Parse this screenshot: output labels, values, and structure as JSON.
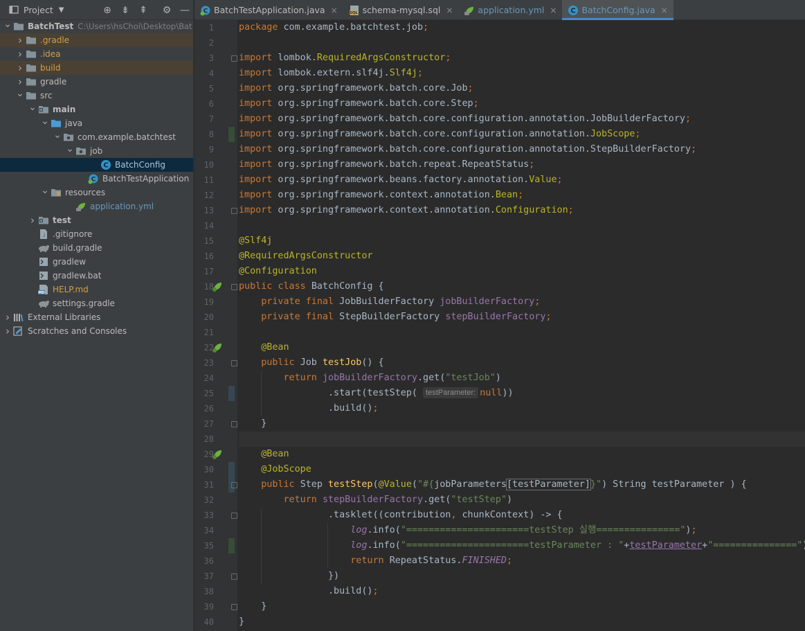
{
  "project_panel": {
    "title": "Project"
  },
  "tree": [
    {
      "label": "BatchTest",
      "path": "C:\\Users\\hsChoi\\Desktop\\Bat",
      "indent": 0,
      "arrow": "down",
      "icon": "folder-icon",
      "bold": true
    },
    {
      "label": ".gradle",
      "indent": 1,
      "arrow": "right",
      "icon": "folder-icon",
      "color": "#d0a043",
      "hl": "o"
    },
    {
      "label": ".idea",
      "indent": 1,
      "arrow": "right",
      "icon": "folder-icon",
      "color": "#d0a043"
    },
    {
      "label": "build",
      "indent": 1,
      "arrow": "right",
      "icon": "folder-icon",
      "color": "#d0a043",
      "hl": "o"
    },
    {
      "label": "gradle",
      "indent": 1,
      "arrow": "right",
      "icon": "folder-icon"
    },
    {
      "label": "src",
      "indent": 1,
      "arrow": "down",
      "icon": "folder-icon"
    },
    {
      "label": "main",
      "indent": 2,
      "arrow": "down",
      "icon": "module-folder-icon",
      "bold": true
    },
    {
      "label": "java",
      "indent": 3,
      "arrow": "down",
      "icon": "source-folder-icon"
    },
    {
      "label": "com.example.batchtest",
      "indent": 4,
      "arrow": "down",
      "icon": "package-icon"
    },
    {
      "label": "job",
      "indent": 5,
      "arrow": "down",
      "icon": "package-icon"
    },
    {
      "label": "BatchConfig",
      "indent": 7,
      "arrow": "",
      "icon": "class-icon",
      "color": "#a9c2dd",
      "sel": true
    },
    {
      "label": "BatchTestApplication",
      "indent": 6,
      "arrow": "",
      "icon": "spring-class-icon"
    },
    {
      "label": "resources",
      "indent": 3,
      "arrow": "down",
      "icon": "resources-folder-icon"
    },
    {
      "label": "application.yml",
      "indent": 5,
      "arrow": "",
      "icon": "yml-icon",
      "color": "#6897bb"
    },
    {
      "label": "test",
      "indent": 2,
      "arrow": "right",
      "icon": "module-folder-icon",
      "bold": true
    },
    {
      "label": ".gitignore",
      "indent": 2,
      "arrow": "",
      "icon": "gitignore-icon"
    },
    {
      "label": "build.gradle",
      "indent": 2,
      "arrow": "",
      "icon": "gradle-icon"
    },
    {
      "label": "gradlew",
      "indent": 2,
      "arrow": "",
      "icon": "terminal-icon"
    },
    {
      "label": "gradlew.bat",
      "indent": 2,
      "arrow": "",
      "icon": "bat-icon"
    },
    {
      "label": "HELP.md",
      "indent": 2,
      "arrow": "",
      "icon": "markdown-icon",
      "color": "#d0a043"
    },
    {
      "label": "settings.gradle",
      "indent": 2,
      "arrow": "",
      "icon": "gradle-icon"
    },
    {
      "label": "External Libraries",
      "indent": 0,
      "arrow": "right",
      "icon": "libraries-icon"
    },
    {
      "label": "Scratches and Consoles",
      "indent": 0,
      "arrow": "right",
      "icon": "scratches-icon"
    }
  ],
  "tabs": [
    {
      "label": "BatchTestApplication.java",
      "icon": "spring-class-icon",
      "active": false,
      "color": "#bbbbbb"
    },
    {
      "label": "schema-mysql.sql",
      "icon": "sql-icon",
      "active": false,
      "color": "#bbbbbb"
    },
    {
      "label": "application.yml",
      "icon": "yml-icon",
      "active": false,
      "color": "#6897bb"
    },
    {
      "label": "BatchConfig.java",
      "icon": "class-icon",
      "active": true,
      "color": "#6897bb"
    }
  ],
  "colors": {
    "keyword": "#cc7832",
    "annotation": "#bbb529",
    "string": "#6a8759",
    "field": "#9876aa",
    "method": "#ffc66d",
    "text": "#a9b7c6"
  },
  "code": [
    [
      [
        "k",
        "package"
      ],
      [
        "t",
        " com.example.batchtest.job"
      ],
      [
        "k",
        ";"
      ]
    ],
    [],
    [
      [
        "k",
        "import"
      ],
      [
        "t",
        " lombok."
      ],
      [
        "a",
        "RequiredArgsConstructor"
      ],
      [
        "k",
        ";"
      ]
    ],
    [
      [
        "k",
        "import"
      ],
      [
        "t",
        " lombok.extern.slf4j."
      ],
      [
        "a",
        "Slf4j"
      ],
      [
        "k",
        ";"
      ]
    ],
    [
      [
        "k",
        "import"
      ],
      [
        "t",
        " org.springframework.batch.core.Job"
      ],
      [
        "k",
        ";"
      ]
    ],
    [
      [
        "k",
        "import"
      ],
      [
        "t",
        " org.springframework.batch.core.Step"
      ],
      [
        "k",
        ";"
      ]
    ],
    [
      [
        "k",
        "import"
      ],
      [
        "t",
        " org.springframework.batch.core.configuration.annotation.JobBuilderFactory"
      ],
      [
        "k",
        ";"
      ]
    ],
    [
      [
        "k",
        "import"
      ],
      [
        "t",
        " org.springframework.batch.core.configuration.annotation."
      ],
      [
        "a",
        "JobScope"
      ],
      [
        "k",
        ";"
      ]
    ],
    [
      [
        "k",
        "import"
      ],
      [
        "t",
        " org.springframework.batch.core.configuration.annotation.StepBuilderFactory"
      ],
      [
        "k",
        ";"
      ]
    ],
    [
      [
        "k",
        "import"
      ],
      [
        "t",
        " org.springframework.batch.repeat.RepeatStatus"
      ],
      [
        "k",
        ";"
      ]
    ],
    [
      [
        "k",
        "import"
      ],
      [
        "t",
        " org.springframework.beans.factory.annotation."
      ],
      [
        "a",
        "Value"
      ],
      [
        "k",
        ";"
      ]
    ],
    [
      [
        "k",
        "import"
      ],
      [
        "t",
        " org.springframework.context.annotation."
      ],
      [
        "a",
        "Bean"
      ],
      [
        "k",
        ";"
      ]
    ],
    [
      [
        "k",
        "import"
      ],
      [
        "t",
        " org.springframework.context.annotation."
      ],
      [
        "a",
        "Configuration"
      ],
      [
        "k",
        ";"
      ]
    ],
    [],
    [
      [
        "a",
        "@Slf4j"
      ]
    ],
    [
      [
        "a",
        "@RequiredArgsConstructor"
      ]
    ],
    [
      [
        "a",
        "@Configuration"
      ]
    ],
    [
      [
        "k",
        "public class "
      ],
      [
        "t",
        "BatchConfig {"
      ]
    ],
    [
      [
        "t",
        "    "
      ],
      [
        "k",
        "private final "
      ],
      [
        "t",
        "JobBuilderFactory "
      ],
      [
        "f",
        "jobBuilderFactory"
      ],
      [
        "k",
        ";"
      ]
    ],
    [
      [
        "t",
        "    "
      ],
      [
        "k",
        "private final "
      ],
      [
        "t",
        "StepBuilderFactory "
      ],
      [
        "f",
        "stepBuilderFactory"
      ],
      [
        "k",
        ";"
      ]
    ],
    [],
    [
      [
        "t",
        "    "
      ],
      [
        "a",
        "@Bean"
      ]
    ],
    [
      [
        "t",
        "    "
      ],
      [
        "k",
        "public "
      ],
      [
        "t",
        "Job "
      ],
      [
        "m",
        "testJob"
      ],
      [
        "t",
        "() {"
      ]
    ],
    [
      [
        "t",
        "        "
      ],
      [
        "k",
        "return "
      ],
      [
        "f",
        "jobBuilderFactory"
      ],
      [
        "t",
        ".get("
      ],
      [
        "s",
        "\"testJob\""
      ],
      [
        "t",
        ")"
      ]
    ],
    [
      [
        "t",
        "                .start(testStep( "
      ],
      [
        "h",
        "testParameter:"
      ],
      [
        "k",
        "null"
      ],
      [
        "t",
        "))"
      ]
    ],
    [
      [
        "t",
        "                .build()"
      ],
      [
        "k",
        ";"
      ]
    ],
    [
      [
        "t",
        "    }"
      ]
    ],
    [],
    [
      [
        "t",
        "    "
      ],
      [
        "a",
        "@Bean"
      ]
    ],
    [
      [
        "t",
        "    "
      ],
      [
        "a",
        "@JobScope"
      ]
    ],
    [
      [
        "t",
        "    "
      ],
      [
        "k",
        "public "
      ],
      [
        "t",
        "Step "
      ],
      [
        "m",
        "testStep"
      ],
      [
        "t",
        "("
      ],
      [
        "a",
        "@Value"
      ],
      [
        "t",
        "("
      ],
      [
        "s",
        "\"#{"
      ],
      [
        "t",
        "jobParameters"
      ],
      [
        "b",
        "[testParameter]"
      ],
      [
        "s",
        "}\""
      ],
      [
        "t",
        ") String testParameter ) {"
      ]
    ],
    [
      [
        "t",
        "        "
      ],
      [
        "k",
        "return "
      ],
      [
        "f",
        "stepBuilderFactory"
      ],
      [
        "t",
        ".get("
      ],
      [
        "s",
        "\"testStep\""
      ],
      [
        "t",
        ")"
      ]
    ],
    [
      [
        "t",
        "                .tasklet((contribution"
      ],
      [
        "k",
        ", "
      ],
      [
        "t",
        "chunkContext) -> {"
      ]
    ],
    [
      [
        "t",
        "                    "
      ],
      [
        "fi",
        "log"
      ],
      [
        "t",
        ".info("
      ],
      [
        "s",
        "\"======================testStep 실행===============\""
      ],
      [
        "t",
        ")"
      ],
      [
        "k",
        ";"
      ]
    ],
    [
      [
        "t",
        "                    "
      ],
      [
        "fi",
        "log"
      ],
      [
        "t",
        ".info("
      ],
      [
        "s",
        "\"======================testParameter : \""
      ],
      [
        "t",
        "+"
      ],
      [
        "u",
        "testParameter"
      ],
      [
        "t",
        "+"
      ],
      [
        "s",
        "\"===============\""
      ],
      [
        "t",
        ")"
      ],
      [
        "k",
        ";"
      ]
    ],
    [
      [
        "t",
        "                    "
      ],
      [
        "k",
        "return "
      ],
      [
        "t",
        "RepeatStatus."
      ],
      [
        "fi",
        "FINISHED"
      ],
      [
        "k",
        ";"
      ]
    ],
    [
      [
        "t",
        "                })"
      ]
    ],
    [
      [
        "t",
        "                .build()"
      ],
      [
        "k",
        ";"
      ]
    ],
    [
      [
        "t",
        "    }"
      ]
    ],
    [
      [
        "t",
        "}"
      ]
    ]
  ]
}
